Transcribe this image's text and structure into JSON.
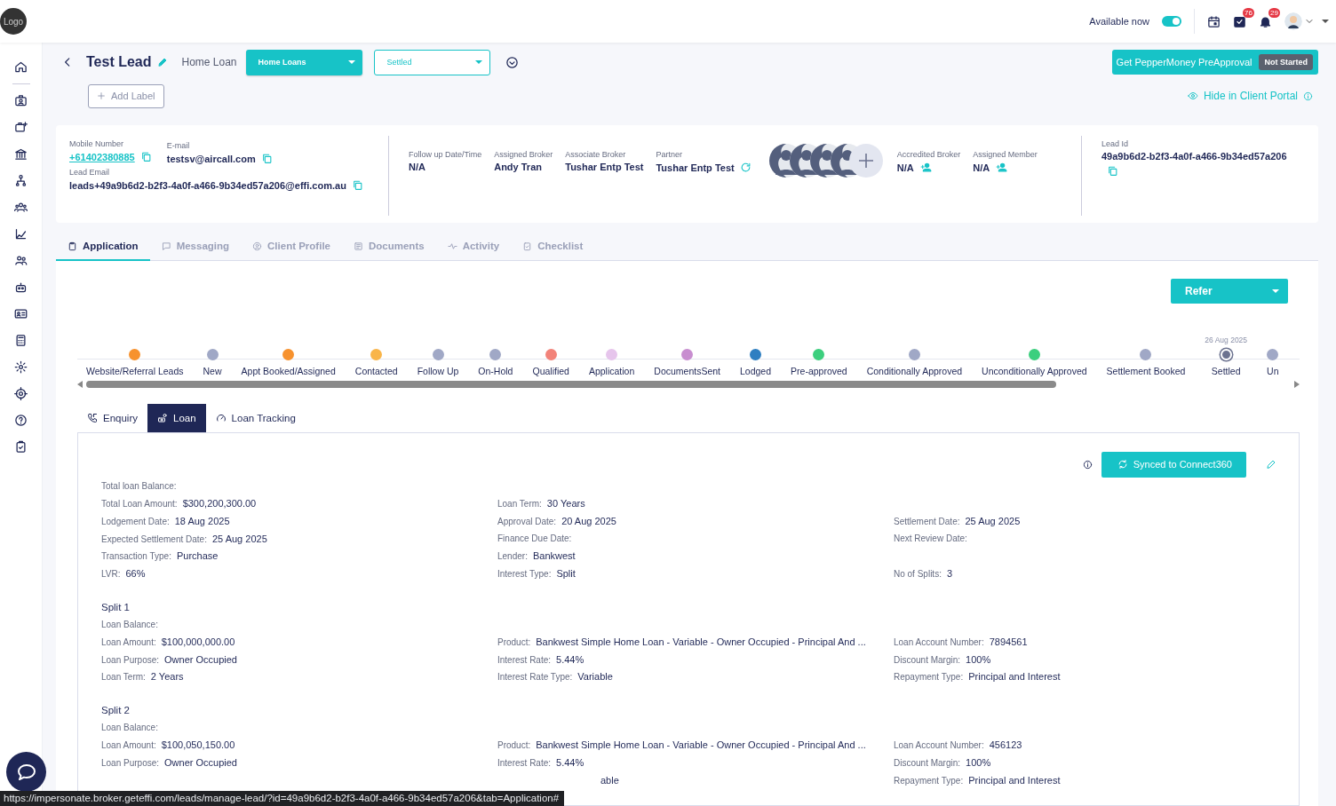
{
  "topbar": {
    "logo": "Logo",
    "availability_label": "Available now",
    "available": true,
    "task_badge": "76",
    "notification_badge": "29"
  },
  "header": {
    "title": "Test Lead",
    "loan_kind": "Home Loan",
    "category_dropdown": "Home Loans",
    "status_dropdown": "Settled",
    "add_label": "Add Label",
    "preapproval_button": "Get PepperMoney PreApproval",
    "preapproval_status": "Not Started",
    "portal_link": "Hide in Client Portal"
  },
  "contact": {
    "mobile_label": "Mobile Number",
    "mobile": "+61402380885",
    "email_label": "E-mail",
    "email": "testsv@aircall.com",
    "lead_email_label": "Lead Email",
    "lead_email": "leads+49a9b6d2-b2f3-4a0f-a466-9b34ed57a206@effi.com.au"
  },
  "people": [
    {
      "label": "Follow up Date/Time",
      "value": "N/A",
      "kind": "plain"
    },
    {
      "label": "Assigned Broker",
      "value": "Andy Tran",
      "kind": "plain"
    },
    {
      "label": "Associate Broker",
      "value": "Tushar Entp Test",
      "kind": "plain"
    },
    {
      "label": "Partner",
      "value": "Tushar Entp Test",
      "kind": "refresh"
    },
    {
      "kind": "avatars"
    },
    {
      "label": "Accredited Broker",
      "value": "N/A",
      "kind": "assign"
    },
    {
      "label": "Assigned Member",
      "value": "N/A",
      "kind": "assign"
    }
  ],
  "lead_id": {
    "label": "Lead Id",
    "value": "49a9b6d2-b2f3-4a0f-a466-9b34ed57a206"
  },
  "tabs": [
    {
      "label": "Application",
      "selected": true
    },
    {
      "label": "Messaging",
      "selected": false
    },
    {
      "label": "Client Profile",
      "selected": false
    },
    {
      "label": "Documents",
      "selected": false
    },
    {
      "label": "Activity",
      "selected": false
    },
    {
      "label": "Checklist",
      "selected": false
    }
  ],
  "refer_button": "Refer",
  "pipeline": {
    "stages": [
      {
        "label": "Website/Referral Leads",
        "color": "#f7922e",
        "selected": false
      },
      {
        "label": "New",
        "color": "#a0a8c6",
        "selected": false
      },
      {
        "label": "Appt Booked/Assigned",
        "color": "#f7922e",
        "selected": false
      },
      {
        "label": "Contacted",
        "color": "#f9b54a",
        "selected": false
      },
      {
        "label": "Follow Up",
        "color": "#a0a8c6",
        "selected": false
      },
      {
        "label": "On-Hold",
        "color": "#a0a8c6",
        "selected": false
      },
      {
        "label": "Qualified",
        "color": "#f2837a",
        "selected": false
      },
      {
        "label": "Application",
        "color": "#e6c5ec",
        "selected": false
      },
      {
        "label": "DocumentsSent",
        "color": "#c88ed0",
        "selected": false
      },
      {
        "label": "Lodged",
        "color": "#2f7fc1",
        "selected": false
      },
      {
        "label": "Pre-approved",
        "color": "#3ccf7e",
        "selected": false
      },
      {
        "label": "Conditionally Approved",
        "color": "#a0a8c6",
        "selected": false
      },
      {
        "label": "Unconditionally Approved",
        "color": "#3ccf7e",
        "selected": false
      },
      {
        "label": "Settlement Booked",
        "color": "#a0a8c6",
        "selected": false
      },
      {
        "label": "Settled",
        "color": "#6c7390",
        "selected": true,
        "date": "26 Aug 2025"
      },
      {
        "label": "Un",
        "color": "#a0a8c6",
        "selected": false
      }
    ]
  },
  "subtabs": [
    {
      "label": "Enquiry",
      "selected": false
    },
    {
      "label": "Loan",
      "selected": true
    },
    {
      "label": "Loan Tracking",
      "selected": false
    }
  ],
  "sync_button": "Synced to Connect360",
  "summary": [
    {
      "left": {
        "label": "Total loan Balance:"
      }
    },
    {
      "left": {
        "label": "Total Loan Amount:",
        "value": "$300,200,300.00"
      },
      "middle": {
        "label": "Loan Term:",
        "value": "30 Years"
      }
    },
    {
      "left": {
        "label": "Lodgement Date:",
        "value": "18 Aug 2025"
      },
      "middle": {
        "label": "Approval Date:",
        "value": "20 Aug 2025"
      },
      "right": {
        "label": "Settlement Date:",
        "value": "25 Aug 2025"
      }
    },
    {
      "left": {
        "label": "Expected Settlement Date:",
        "value": "25 Aug 2025"
      },
      "middle": {
        "label": "Finance Due Date:"
      },
      "right": {
        "label": "Next Review Date:"
      }
    },
    {
      "left": {
        "label": "Transaction Type:",
        "value": "Purchase"
      },
      "middle": {
        "label": "Lender:",
        "value": "Bankwest"
      }
    },
    {
      "left": {
        "label": "LVR:",
        "value": "66%"
      },
      "middle": {
        "label": "Interest Type:",
        "value": "Split"
      },
      "right": {
        "label": "No of Splits:",
        "value": "3"
      }
    }
  ],
  "splits": [
    {
      "title": "Split 1",
      "rows": [
        {
          "left": {
            "label": "Loan Balance:"
          }
        },
        {
          "left": {
            "label": "Loan Amount:",
            "value": "$100,000,000.00"
          },
          "middle": {
            "label": "Product:",
            "value": "Bankwest Simple Home Loan - Variable - Owner Occupied - Principal And ..."
          },
          "right": {
            "label": "Loan Account Number:",
            "value": "7894561"
          }
        },
        {
          "left": {
            "label": "Loan Purpose:",
            "value": "Owner Occupied"
          },
          "middle": {
            "label": "Interest Rate:",
            "value": "5.44%"
          },
          "right": {
            "label": "Discount Margin:",
            "value": "100%"
          }
        },
        {
          "left": {
            "label": "Loan Term:",
            "value": "2 Years"
          },
          "middle": {
            "label": "Interest Rate Type:",
            "value": "Variable"
          },
          "right": {
            "label": "Repayment Type:",
            "value": "Principal and Interest"
          }
        }
      ]
    },
    {
      "title": "Split 2",
      "rows": [
        {
          "left": {
            "label": "Loan Balance:"
          }
        },
        {
          "left": {
            "label": "Loan Amount:",
            "value": "$100,050,150.00"
          },
          "middle": {
            "label": "Product:",
            "value": "Bankwest Simple Home Loan - Variable - Owner Occupied - Principal And ..."
          },
          "right": {
            "label": "Loan Account Number:",
            "value": "456123"
          }
        },
        {
          "left": {
            "label": "Loan Purpose:",
            "value": "Owner Occupied"
          },
          "middle": {
            "label": "Interest Rate:",
            "value": "5.44%"
          },
          "right": {
            "label": "Discount Margin:",
            "value": "100%"
          }
        },
        {
          "middle": {
            "value": "able"
          },
          "right": {
            "label": "Repayment Type:",
            "value": "Principal and Interest"
          }
        }
      ]
    }
  ],
  "status_url": "https://impersonate.broker.geteffi.com/leads/manage-lead/?id=49a9b6d2-b2f3-4a0f-a466-9b34ed57a206&tab=Application#"
}
